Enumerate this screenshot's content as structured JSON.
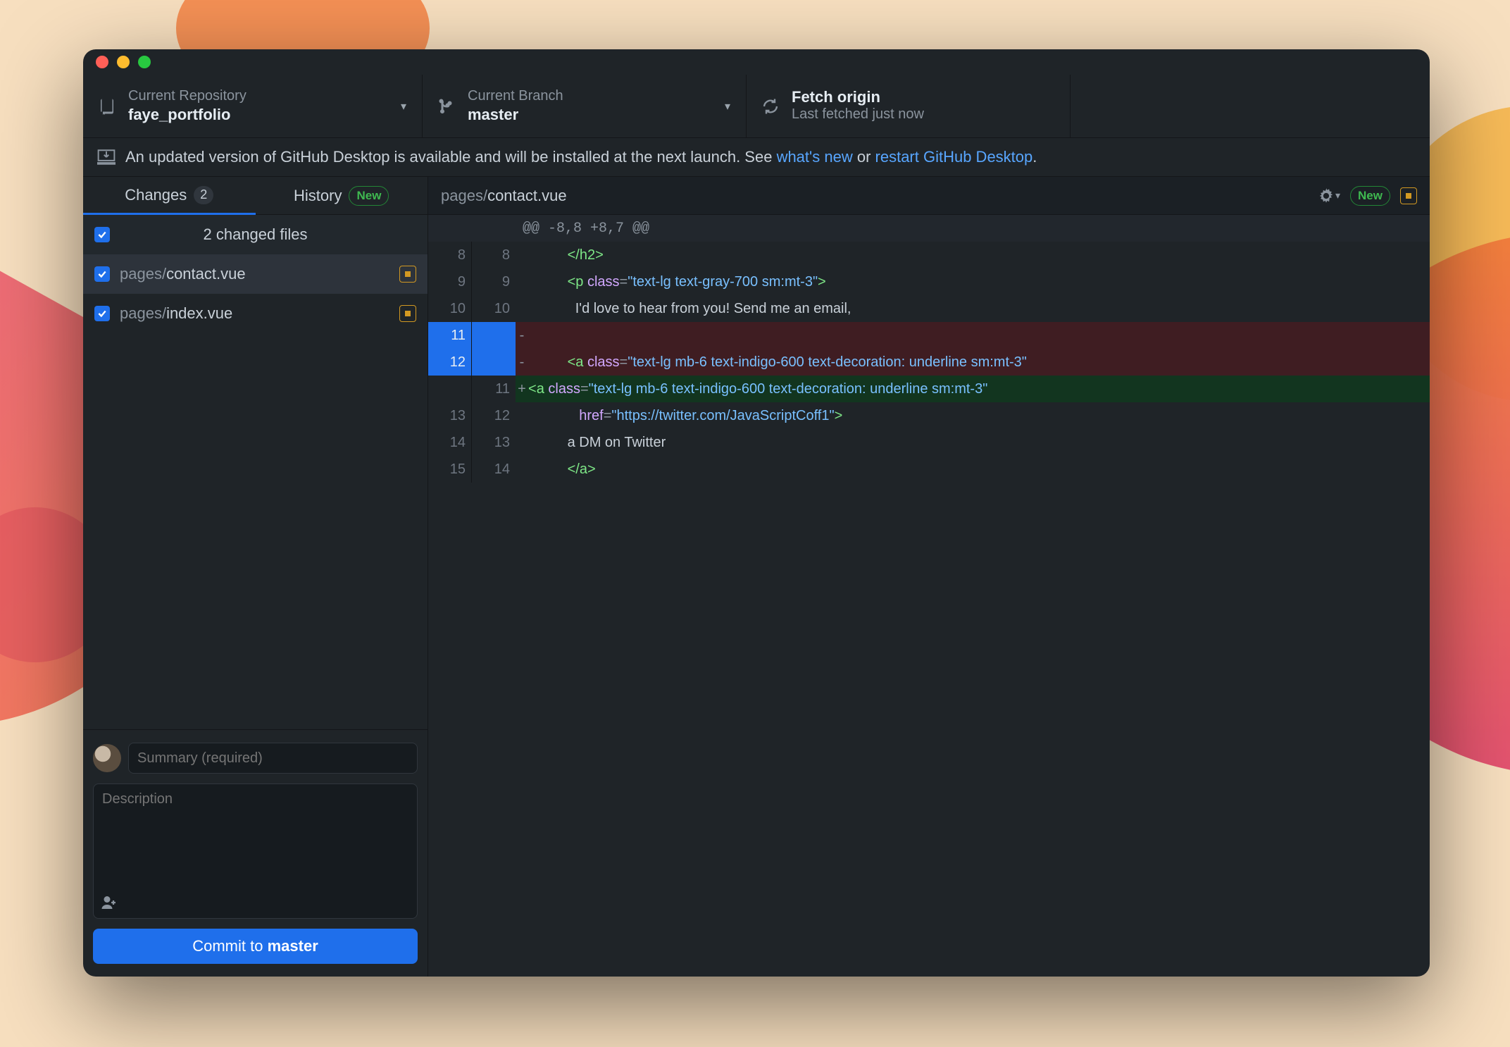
{
  "toolbar": {
    "repo": {
      "label": "Current Repository",
      "value": "faye_portfolio"
    },
    "branch": {
      "label": "Current Branch",
      "value": "master"
    },
    "fetch": {
      "title": "Fetch origin",
      "subtitle": "Last fetched just now"
    }
  },
  "banner": {
    "pre": "An updated version of GitHub Desktop is available and will be installed at the next launch. See ",
    "link1": "what's new",
    "mid": " or ",
    "link2": "restart GitHub Desktop",
    "post": "."
  },
  "tabs": {
    "changes": "Changes",
    "changes_count": "2",
    "history": "History",
    "history_badge": "New"
  },
  "files": {
    "header": "2 changed files",
    "items": [
      {
        "dir": "pages/",
        "name": "contact.vue",
        "selected": true
      },
      {
        "dir": "pages/",
        "name": "index.vue",
        "selected": false
      }
    ]
  },
  "commit": {
    "summary_placeholder": "Summary (required)",
    "description_placeholder": "Description",
    "button_prefix": "Commit to ",
    "button_branch": "master"
  },
  "diff": {
    "path_dir": "pages/",
    "path_name": "contact.vue",
    "new_badge": "New",
    "hunk": "@@ -8,8 +8,7 @@",
    "rows": [
      {
        "a": "8",
        "b": "8",
        "t": "ctx",
        "tokens": [
          [
            "sp",
            "          "
          ],
          [
            "tag",
            "</"
          ],
          [
            "tag",
            "h2"
          ],
          [
            "tag",
            ">"
          ]
        ]
      },
      {
        "a": "9",
        "b": "9",
        "t": "ctx",
        "tokens": [
          [
            "sp",
            "          "
          ],
          [
            "tag",
            "<"
          ],
          [
            "tag",
            "p "
          ],
          [
            "attr",
            "class"
          ],
          [
            "sym",
            "="
          ],
          [
            "str",
            "\"text-lg text-gray-700 sm:mt-3\""
          ],
          [
            "tag",
            ">"
          ]
        ]
      },
      {
        "a": "10",
        "b": "10",
        "t": "ctx",
        "tokens": [
          [
            "sp",
            "            "
          ],
          [
            "text",
            "I'd love to hear from you! Send me an email,"
          ]
        ]
      },
      {
        "a": "11",
        "b": "",
        "t": "del",
        "tokens": []
      },
      {
        "a": "12",
        "b": "",
        "t": "del",
        "tokens": [
          [
            "sp",
            "          "
          ],
          [
            "tag",
            "<"
          ],
          [
            "tag",
            "a "
          ],
          [
            "attr",
            "class"
          ],
          [
            "sym",
            "="
          ],
          [
            "str",
            "\"text-lg mb-6 text-indigo-600 text-decoration: underline sm:mt-3\""
          ]
        ]
      },
      {
        "a": "",
        "b": "11",
        "t": "add",
        "tokens": [
          [
            "tag",
            "<"
          ],
          [
            "tag",
            "a "
          ],
          [
            "attr",
            "class"
          ],
          [
            "sym",
            "="
          ],
          [
            "str",
            "\"text-lg mb-6 text-indigo-600 text-decoration: underline sm:mt-3\""
          ]
        ]
      },
      {
        "a": "13",
        "b": "12",
        "t": "ctx",
        "tokens": [
          [
            "sp",
            "             "
          ],
          [
            "attr",
            "href"
          ],
          [
            "sym",
            "="
          ],
          [
            "str",
            "\"https://twitter.com/JavaScriptCoff1\""
          ],
          [
            "tag",
            ">"
          ]
        ]
      },
      {
        "a": "14",
        "b": "13",
        "t": "ctx",
        "tokens": [
          [
            "sp",
            "          "
          ],
          [
            "text",
            "a DM on Twitter"
          ]
        ]
      },
      {
        "a": "15",
        "b": "14",
        "t": "ctx",
        "tokens": [
          [
            "sp",
            "          "
          ],
          [
            "tag",
            "</"
          ],
          [
            "tag",
            "a"
          ],
          [
            "tag",
            ">"
          ]
        ]
      }
    ]
  }
}
